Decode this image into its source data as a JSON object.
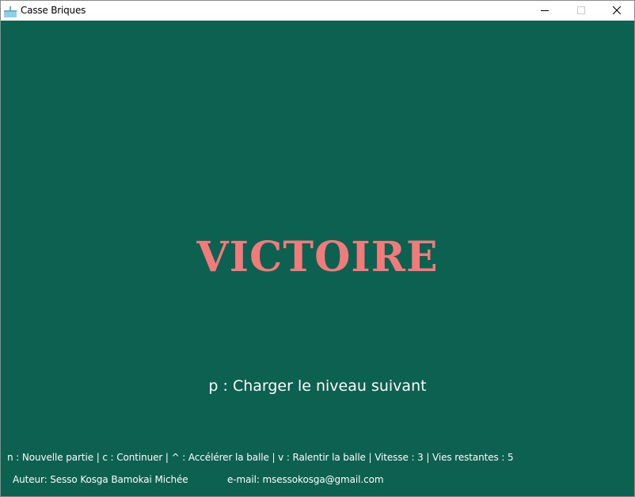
{
  "window": {
    "title": "Casse Briques",
    "icon": "app-icon",
    "controls": {
      "minimize_icon": "minimize-icon",
      "maximize_icon": "maximize-icon",
      "close_icon": "close-icon"
    }
  },
  "game": {
    "background_color": "#0d6150",
    "title_color": "#f17a7a",
    "text_color": "#ffffff",
    "victory_text": "VICTOIRE",
    "next_level_hint": "p : Charger le niveau suivant"
  },
  "footer": {
    "controls_text": "n : Nouvelle partie | c : Continuer | ^ : Accélérer la balle | v : Ralentir la balle | Vitesse : 3 |  Vies restantes : 5",
    "author_text": "Auteur: Sesso Kosga Bamokai Michée",
    "email_text": "e-mail: msessokosga@gmail.com"
  }
}
